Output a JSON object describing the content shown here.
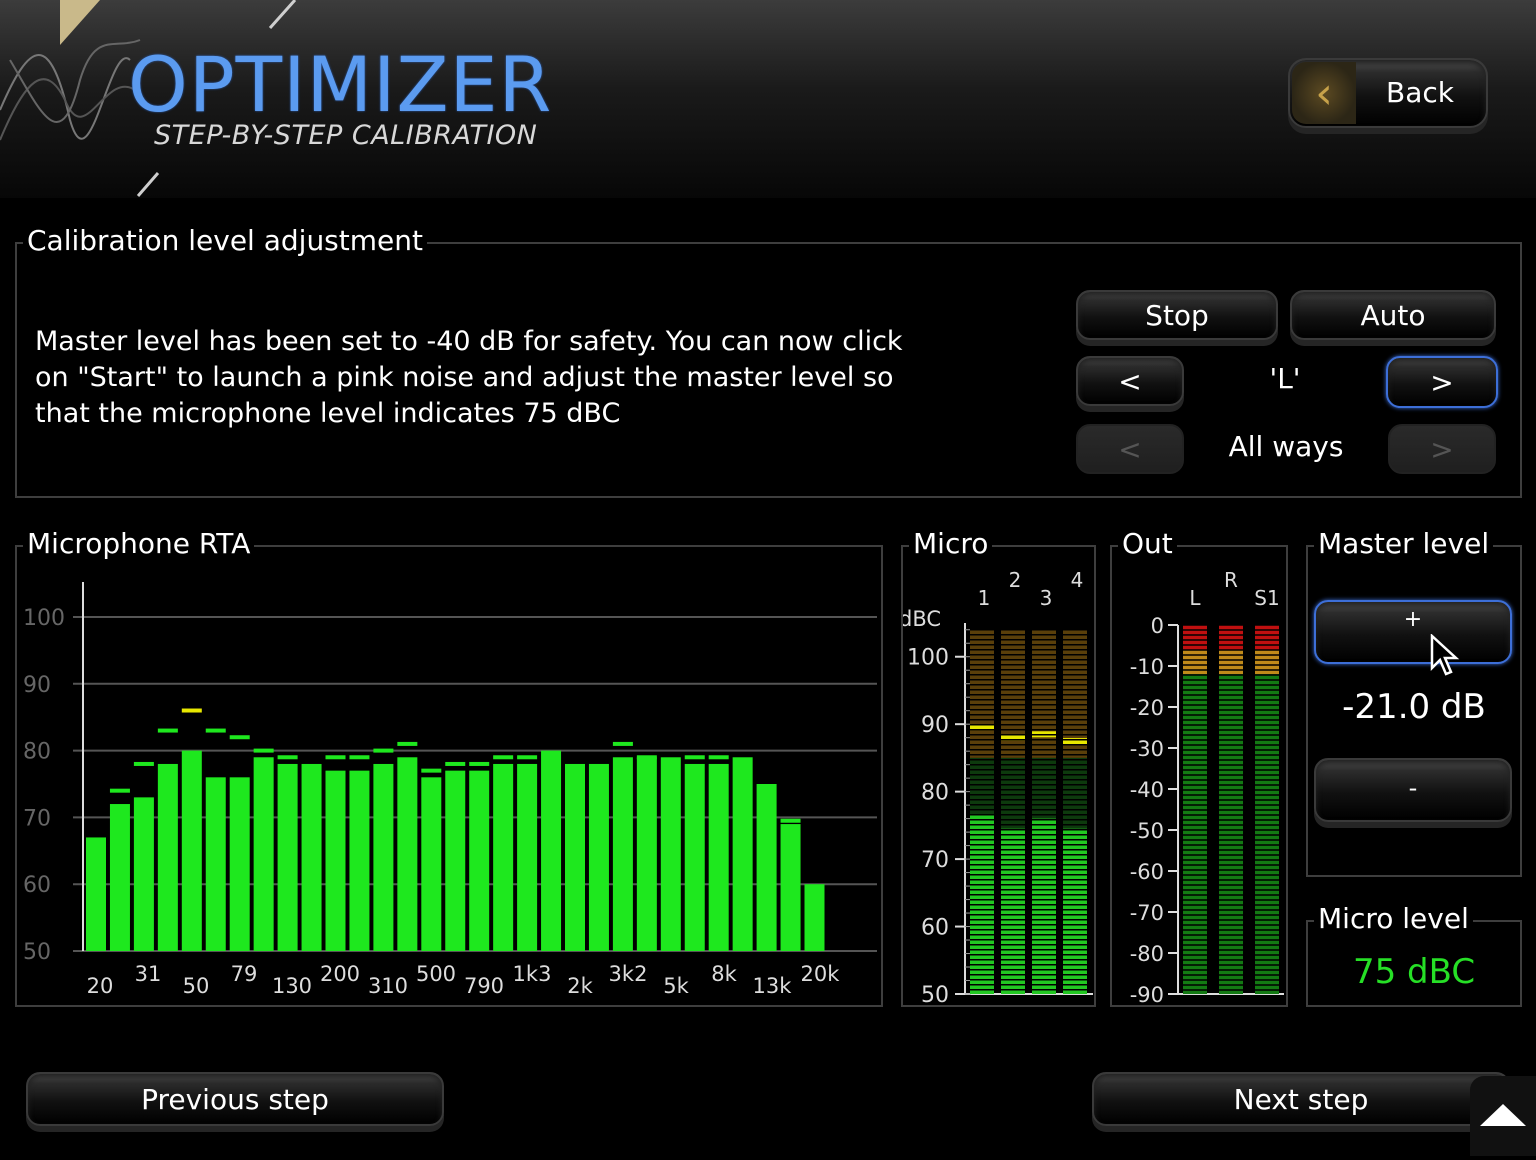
{
  "header": {
    "title": "OPTIMIZER",
    "subtitle": "STEP-BY-STEP CALIBRATION",
    "back_label": "Back"
  },
  "calibration": {
    "title": "Calibration level adjustment",
    "instructions": "Master level has been set to -40 dB for safety. You can now click on \"Start\" to launch a pink noise and adjust the master level so that the microphone level indicates 75 dBC",
    "stop_label": "Stop",
    "auto_label": "Auto",
    "prev_channel_label": "<",
    "next_channel_label": ">",
    "channel": "'L'",
    "prev_way_label": "<",
    "next_way_label": ">",
    "way": "All ways"
  },
  "rta": {
    "title": "Microphone RTA"
  },
  "micro": {
    "title": "Micro",
    "unit": "dBC"
  },
  "out": {
    "title": "Out"
  },
  "master_level": {
    "title": "Master level",
    "plus_label": "+",
    "minus_label": "-",
    "value": "-21.0 dB"
  },
  "micro_level": {
    "title": "Micro level",
    "value": "75 dBC"
  },
  "footer": {
    "previous_label": "Previous step",
    "next_label": "Next step"
  },
  "colors": {
    "accent": "#5b9bf0",
    "bar_green": "#1ee81e",
    "peak_yellow": "#e8e800",
    "meter_orange": "#c08a1a",
    "meter_red": "#c01010",
    "selected_border": "#3d6fd8"
  },
  "chart_data": [
    {
      "type": "bar",
      "name": "rta",
      "ylim": [
        50,
        100
      ],
      "yticks": [
        50,
        60,
        70,
        80,
        90,
        100
      ],
      "tick_labels": [
        "20",
        "31",
        "50",
        "79",
        "130",
        "200",
        "310",
        "500",
        "790",
        "1k3",
        "2k",
        "3k2",
        "5k",
        "8k",
        "13k",
        "20k"
      ],
      "values": [
        67,
        72,
        73,
        78,
        80,
        76,
        76,
        79,
        78,
        78,
        77,
        77,
        78,
        79,
        76,
        77,
        77,
        78,
        78,
        80,
        78,
        78,
        79,
        79,
        79,
        78,
        78,
        79,
        75,
        69,
        60
      ],
      "peaks": [
        null,
        74,
        78,
        83,
        86,
        83,
        82,
        80,
        79,
        null,
        79,
        79,
        80,
        81,
        77,
        78,
        78,
        79,
        79,
        null,
        null,
        null,
        81,
        79,
        null,
        79,
        79,
        null,
        null,
        69.5,
        null
      ]
    },
    {
      "type": "bar",
      "name": "micro",
      "ylim": [
        50,
        105
      ],
      "yticks": [
        50,
        60,
        70,
        80,
        90,
        100
      ],
      "categories": [
        "1",
        "2",
        "3",
        "4"
      ],
      "values": [
        76.5,
        74.5,
        76,
        74.5
      ],
      "peaks": [
        89.5,
        88,
        88.5,
        87.5
      ]
    },
    {
      "type": "bar",
      "name": "out",
      "ylim": [
        -90,
        0
      ],
      "yticks": [
        0,
        -10,
        -20,
        -30,
        -40,
        -50,
        -60,
        -70,
        -80,
        -90
      ],
      "categories": [
        "L",
        "R",
        "S1"
      ],
      "values": [
        -12,
        -12,
        -12
      ]
    }
  ]
}
